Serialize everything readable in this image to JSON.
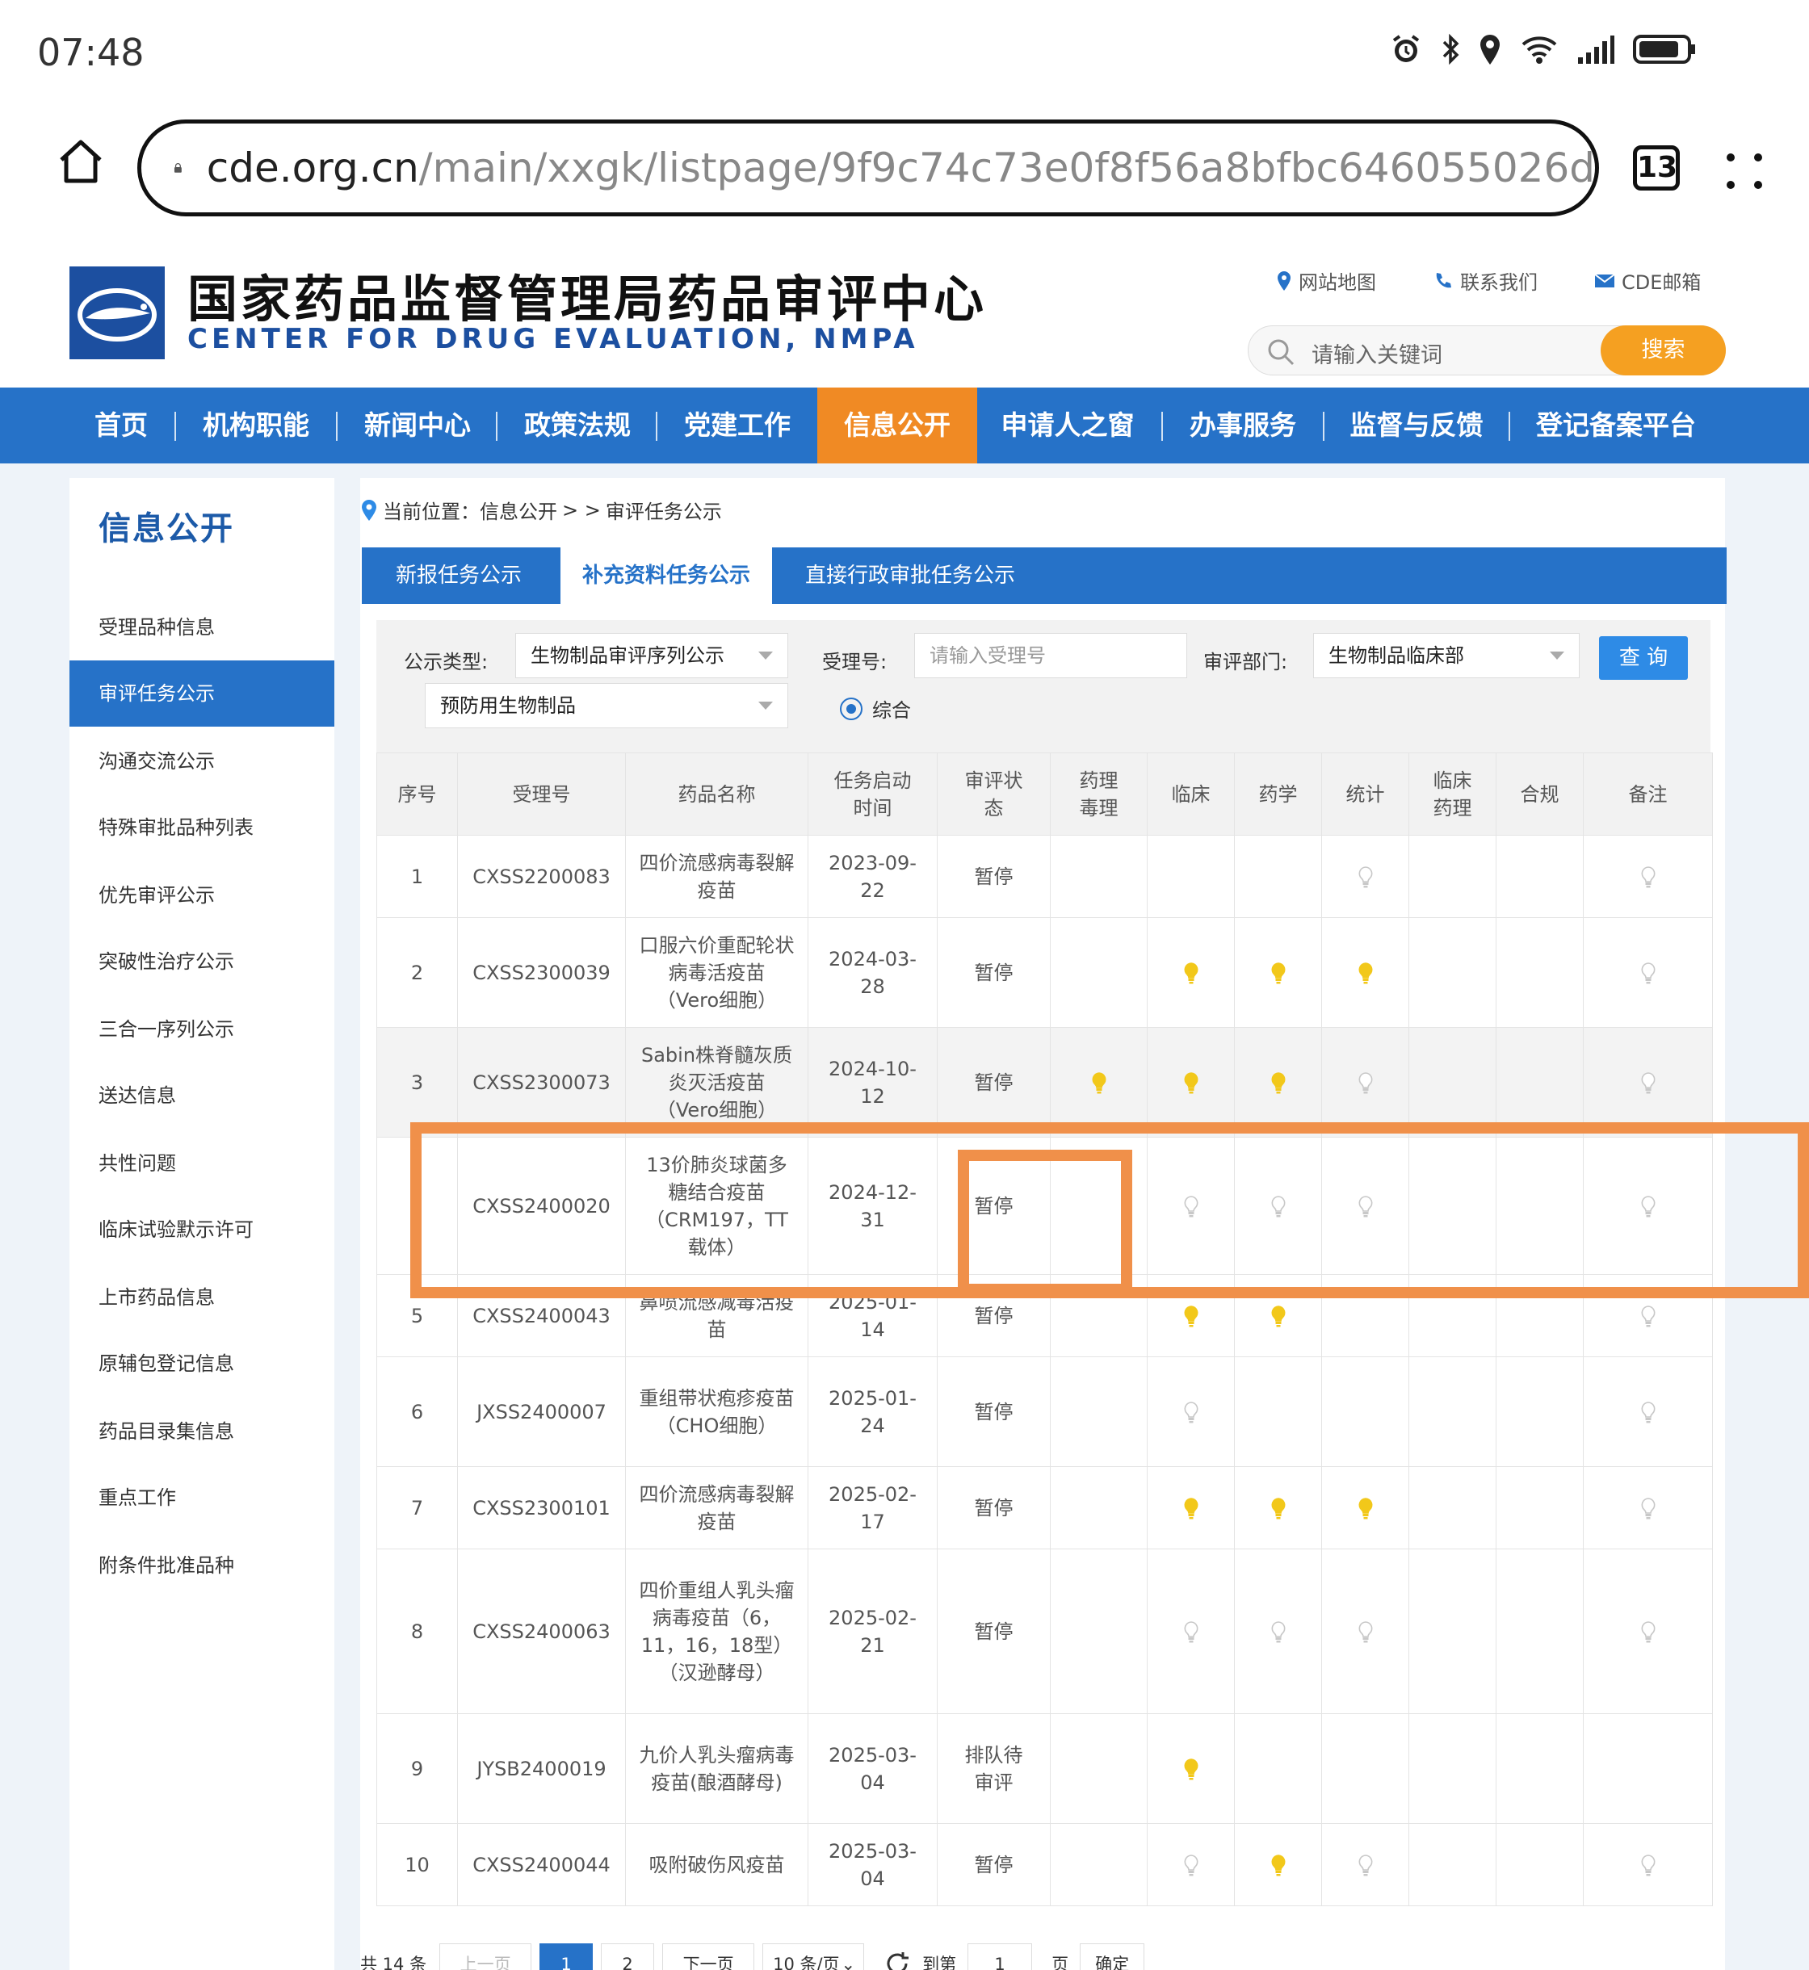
{
  "status": {
    "time": "07:48",
    "battery_label": ""
  },
  "browser": {
    "url_host": "cde.org.cn",
    "url_path": "/main/xxgk/listpage/9f9c74c73e0f8f56a8bfbc646055026d",
    "tab_count": "13"
  },
  "site": {
    "title": "国家药品监督管理局药品审评中心",
    "subtitle": "CENTER FOR DRUG EVALUATION, NMPA",
    "top_links": [
      "网站地图",
      "联系我们",
      "CDE邮箱"
    ],
    "search_placeholder": "请输入关键词",
    "search_button": "搜索"
  },
  "nav": [
    "首页",
    "机构职能",
    "新闻中心",
    "政策法规",
    "党建工作",
    "信息公开",
    "申请人之窗",
    "办事服务",
    "监督与反馈",
    "登记备案平台"
  ],
  "sidebar": {
    "title": "信息公开",
    "items": [
      "受理品种信息",
      "审评任务公示",
      "沟通交流公示",
      "特殊审批品种列表",
      "优先审评公示",
      "突破性治疗公示",
      "三合一序列公示",
      "送达信息",
      "共性问题",
      "临床试验默示许可",
      "上市药品信息",
      "原辅包登记信息",
      "药品目录集信息",
      "重点工作",
      "附条件批准品种"
    ]
  },
  "breadcrumb": {
    "prefix": "当前位置：信息公开",
    "sep": "> >",
    "current": "审评任务公示"
  },
  "tabs": [
    "新报任务公示",
    "补充资料任务公示",
    "直接行政审批任务公示"
  ],
  "filter": {
    "type_label": "公示类型:",
    "type_value": "生物制品审评序列公示",
    "sub_value": "预防用生物制品",
    "acc_label": "受理号:",
    "acc_placeholder": "请输入受理号",
    "dept_label": "审评部门:",
    "dept_value": "生物制品临床部",
    "radio_label": "综合",
    "query_button": "查 询"
  },
  "table": {
    "headers": [
      "序号",
      "受理号",
      "药品名称",
      "任务启动时间",
      "审评状态",
      "药理毒理",
      "临床",
      "药学",
      "统计",
      "临床药理",
      "合规",
      "备注"
    ],
    "rows": [
      {
        "no": "1",
        "acc": "CXSS2200083",
        "name": "四价流感病毒裂解疫苗",
        "date": "2023-09-22",
        "status": "暂停",
        "lights": [
          "",
          "",
          "",
          "off",
          "",
          "",
          "off"
        ]
      },
      {
        "no": "2",
        "acc": "CXSS2300039",
        "name": "口服六价重配轮状病毒活疫苗（Vero细胞）",
        "date": "2024-03-28",
        "status": "暂停",
        "lights": [
          "",
          "on",
          "on",
          "on",
          "",
          "",
          "off"
        ]
      },
      {
        "no": "3",
        "acc": "CXSS2300073",
        "name": "Sabin株脊髓灰质炎灭活疫苗（Vero细胞）",
        "date": "2024-10-12",
        "status": "暂停",
        "lights": [
          "on",
          "on",
          "on",
          "off",
          "",
          "",
          "off"
        ]
      },
      {
        "no": "",
        "acc": "CXSS2400020",
        "name": "13价肺炎球菌多糖结合疫苗（CRM197，TT载体）",
        "date": "2024-12-31",
        "status": "暂停",
        "lights": [
          "",
          "off",
          "off",
          "off",
          "",
          "",
          "off"
        ]
      },
      {
        "no": "5",
        "acc": "CXSS2400043",
        "name": "鼻喷流感减毒活疫苗",
        "date": "2025-01-14",
        "status": "暂停",
        "lights": [
          "",
          "on",
          "on",
          "",
          "",
          "",
          "off"
        ]
      },
      {
        "no": "6",
        "acc": "JXSS2400007",
        "name": "重组带状疱疹疫苗（CHO细胞）",
        "date": "2025-01-24",
        "status": "暂停",
        "lights": [
          "",
          "off",
          "",
          "",
          "",
          "",
          "off"
        ]
      },
      {
        "no": "7",
        "acc": "CXSS2300101",
        "name": "四价流感病毒裂解疫苗",
        "date": "2025-02-17",
        "status": "暂停",
        "lights": [
          "",
          "on",
          "on",
          "on",
          "",
          "",
          "off"
        ]
      },
      {
        "no": "8",
        "acc": "CXSS2400063",
        "name": "四价重组人乳头瘤病毒疫苗（6，11，16，18型）（汉逊酵母）",
        "date": "2025-02-21",
        "status": "暂停",
        "lights": [
          "",
          "off",
          "off",
          "off",
          "",
          "",
          "off"
        ]
      },
      {
        "no": "9",
        "acc": "JYSB2400019",
        "name": "九价人乳头瘤病毒疫苗(酿酒酵母)",
        "date": "2025-03-04",
        "status": "排队待审评",
        "lights": [
          "",
          "on",
          "",
          "",
          "",
          "",
          ""
        ]
      },
      {
        "no": "10",
        "acc": "CXSS2400044",
        "name": "吸附破伤风疫苗",
        "date": "2025-03-04",
        "status": "暂停",
        "lights": [
          "",
          "off",
          "on",
          "off",
          "",
          "",
          "off"
        ]
      }
    ]
  },
  "pagination": {
    "total": "共 14 条",
    "prev": "上一页",
    "pages": [
      "1",
      "2"
    ],
    "next": "下一页",
    "per_page": "10 条/页",
    "goto": "到第",
    "goto_value": "1",
    "page_unit": "页",
    "confirm": "确定"
  },
  "colors": {
    "nav_blue": "#2672c8",
    "accent_orange": "#f08a24",
    "bulb_on": "#f2c81a",
    "bulb_off": "#c8c8c8",
    "annotation": "#f0904a"
  }
}
